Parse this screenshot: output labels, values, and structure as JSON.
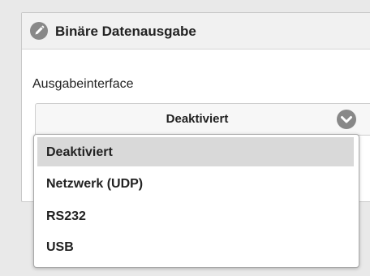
{
  "panel": {
    "title": "Binäre Datenausgabe",
    "icon": "pencil-icon"
  },
  "field": {
    "label": "Ausgabeinterface",
    "selected_value": "Deaktiviert",
    "chevron_icon": "chevron-down-icon"
  },
  "dropdown": {
    "options": [
      {
        "label": "Deaktiviert",
        "selected": true
      },
      {
        "label": "Netzwerk (UDP)",
        "selected": false
      },
      {
        "label": "RS232",
        "selected": false
      },
      {
        "label": "USB",
        "selected": false
      }
    ]
  },
  "colors": {
    "icon_fill": "#888888",
    "selected_option_bg": "#d9d9d9"
  }
}
